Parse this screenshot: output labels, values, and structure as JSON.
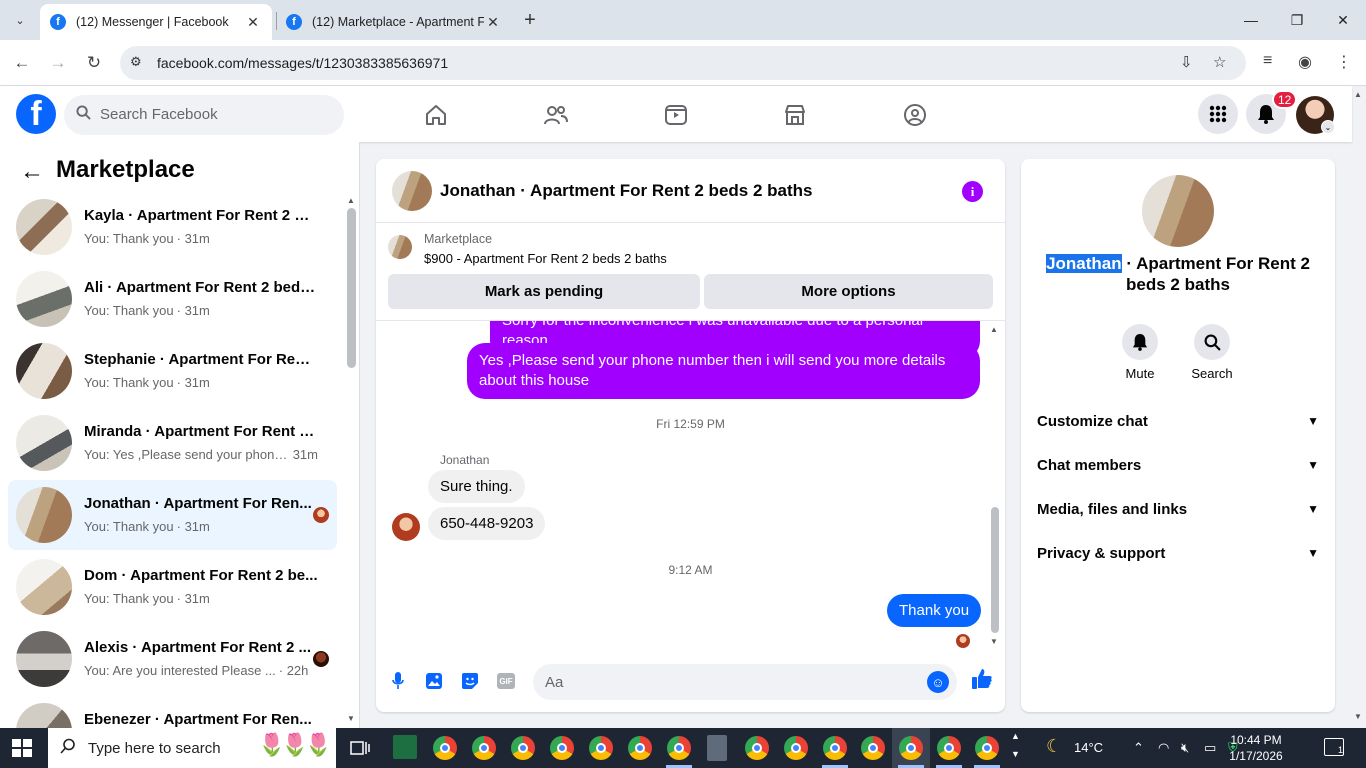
{
  "browser": {
    "tabs": [
      {
        "title": "(12) Messenger | Facebook",
        "active": true
      },
      {
        "title": "(12) Marketplace - Apartment F",
        "active": false
      }
    ],
    "url": "facebook.com/messages/t/1230383385636971"
  },
  "fb": {
    "search_placeholder": "Search Facebook",
    "notification_count": "12"
  },
  "sidebar": {
    "title": "Marketplace",
    "conversations": [
      {
        "name": "Kayla · Apartment For Rent 2 be...",
        "preview": "You: Thank you",
        "time": "· 31m"
      },
      {
        "name": "Ali · Apartment For Rent 2 beds ...",
        "preview": "You: Thank you",
        "time": "· 31m"
      },
      {
        "name": "Stephanie · Apartment For Rent ...",
        "preview": "You: Thank you",
        "time": "· 31m"
      },
      {
        "name": "Miranda · Apartment For Rent 2 ...",
        "preview": "You: Yes ,Please send your phone ...",
        "time": "31m"
      },
      {
        "name": "Jonathan · Apartment For Ren...",
        "preview": "You: Thank you",
        "time": "· 31m"
      },
      {
        "name": "Dom · Apartment For Rent 2 be...",
        "preview": "You: Thank you",
        "time": "· 31m"
      },
      {
        "name": "Alexis · Apartment For Rent 2 ...",
        "preview": "You: Are you interested Please ...",
        "time": "· 22h"
      },
      {
        "name": "Ebenezer · Apartment For Ren...",
        "preview": "",
        "time": ""
      }
    ]
  },
  "chat": {
    "title": "Jonathan · Apartment For Rent 2 beds 2 baths",
    "listing_source": "Marketplace",
    "listing_title": "$900 - Apartment For Rent 2 beds 2 baths",
    "mark_pending": "Mark as pending",
    "more_options": "More options",
    "messages": {
      "out_partial": "Sorry for the inconvenience i was unavailable due to a personal reason",
      "out_1": "Yes ,Please send your phone number then i will send you more details about this house",
      "time_1": "Fri 12:59 PM",
      "sender": "Jonathan",
      "in_1": "Sure thing.",
      "in_2": "650-448-9203",
      "time_2": "9:12 AM",
      "out_2": "Thank you"
    },
    "composer_placeholder": "Aa",
    "gif_label": "GIF"
  },
  "info_panel": {
    "title_highlight": "Jonathan",
    "title_rest": " · Apartment For Rent 2 beds 2 baths",
    "mute": "Mute",
    "search": "Search",
    "sections": [
      "Customize chat",
      "Chat members",
      "Media, files and links",
      "Privacy & support"
    ]
  },
  "taskbar": {
    "search_placeholder": "Type here to search",
    "weather": "14°C",
    "time": "10:44 PM",
    "date": "1/17/2026",
    "notification_count": "1"
  }
}
